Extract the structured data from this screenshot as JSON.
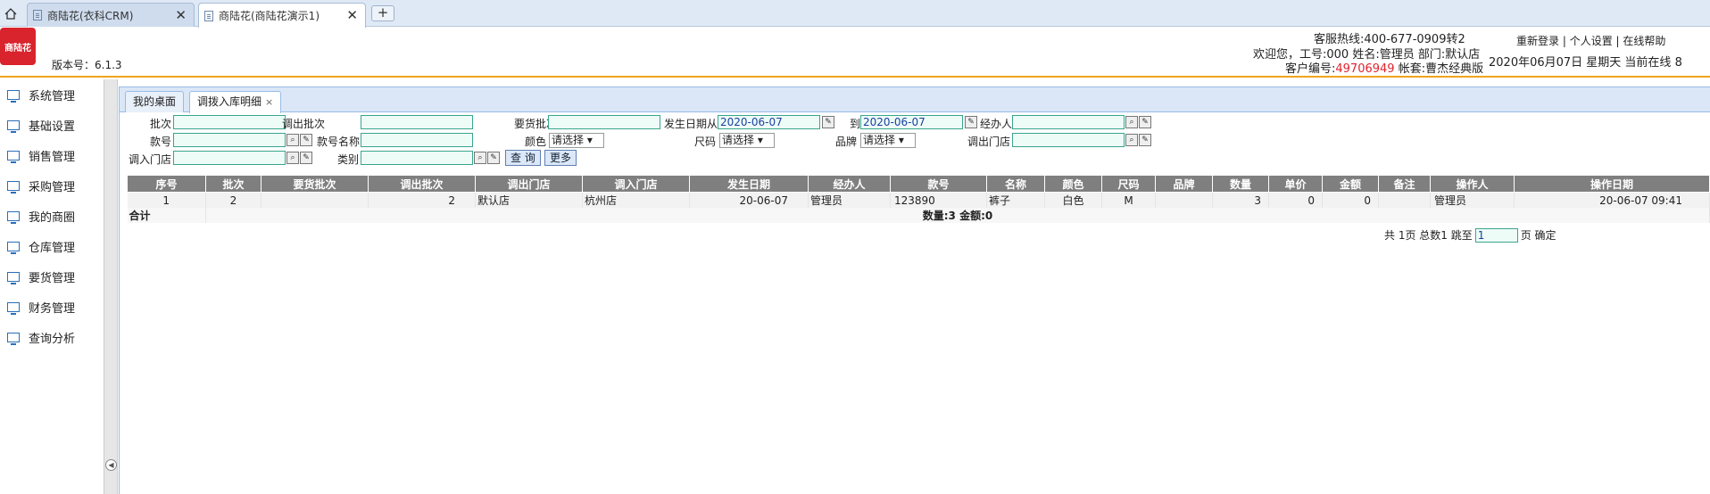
{
  "browser": {
    "tabs": [
      {
        "label": "商陆花(衣科CRM)"
      },
      {
        "label": "商陆花(商陆花演示1)"
      }
    ],
    "new_tab": "+",
    "close": "✕"
  },
  "header": {
    "logo": "商陆花",
    "version": "版本号：6.1.3",
    "hotline": "客服热线:400-677-0909转2",
    "welcome": "欢迎您，工号:000 姓名:管理员 部门:默认店",
    "cust_label": "客户编号:",
    "cust_no": "49706949",
    "account": " 帐套:曹杰经典版",
    "links": [
      "重新登录",
      "个人设置",
      "在线帮助"
    ],
    "date": "2020年06月07日 星期天 当前在线 8"
  },
  "sidebar": {
    "items": [
      {
        "label": "系统管理"
      },
      {
        "label": "基础设置"
      },
      {
        "label": "销售管理"
      },
      {
        "label": "采购管理"
      },
      {
        "label": "我的商圈"
      },
      {
        "label": "仓库管理"
      },
      {
        "label": "要货管理"
      },
      {
        "label": "财务管理"
      },
      {
        "label": "查询分析"
      }
    ]
  },
  "page_tabs": [
    {
      "label": "我的桌面"
    },
    {
      "label": "调拨入库明细"
    }
  ],
  "filters": {
    "batch": "批次",
    "out_batch": "调出批次",
    "req_batch": "要货批次",
    "date_from": "发生日期从",
    "date_from_val": "2020-06-07",
    "to": "到",
    "date_to_val": "2020-06-07",
    "handler": "经办人",
    "style_no": "款号",
    "style_name": "款号名称",
    "color": "颜色",
    "size": "尺码",
    "brand": "品牌",
    "out_store": "调出门店",
    "in_store": "调入门店",
    "category": "类别",
    "select_placeholder": "请选择",
    "query_btn": "查 询",
    "more_btn": "更多"
  },
  "table": {
    "headers": [
      "序号",
      "批次",
      "要货批次",
      "调出批次",
      "调出门店",
      "调入门店",
      "发生日期",
      "经办人",
      "款号",
      "名称",
      "颜色",
      "尺码",
      "品牌",
      "数量",
      "单价",
      "金额",
      "备注",
      "操作人",
      "操作日期"
    ],
    "row": {
      "seq": "1",
      "batch": "2",
      "req_batch": "",
      "out_batch": "2",
      "out_store": "默认店",
      "in_store": "杭州店",
      "date": "20-06-07",
      "handler": "管理员",
      "style_no": "123890",
      "name": "裤子",
      "color": "白色",
      "size": "M",
      "brand": "",
      "qty": "3",
      "price": "0",
      "amount": "0",
      "remark": "",
      "operator": "管理员",
      "op_date": "20-06-07 09:41"
    },
    "summary_label": "合计",
    "summary_text": "数量:3 金额:0"
  },
  "pager": {
    "info": "共 1页 总数1 跳至",
    "page_value": "1",
    "suffix": "页 确定"
  }
}
